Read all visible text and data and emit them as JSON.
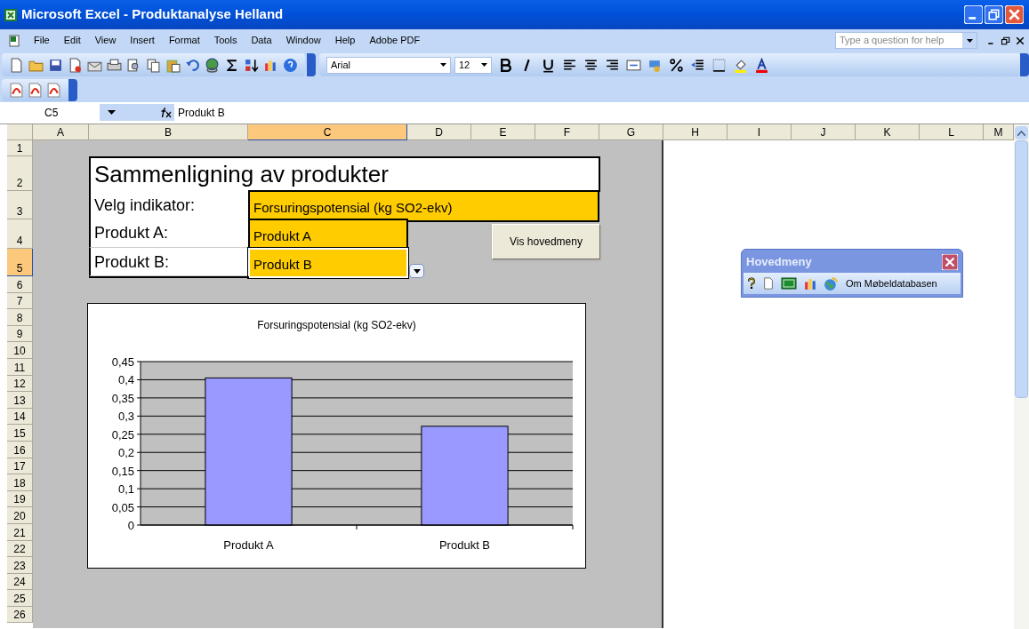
{
  "window": {
    "title": "Microsoft Excel - Produktanalyse Helland"
  },
  "menu_bar": {
    "items": [
      "File",
      "Edit",
      "View",
      "Insert",
      "Format",
      "Tools",
      "Data",
      "Window",
      "Help",
      "Adobe PDF"
    ],
    "help_box": {
      "placeholder": "Type a question for help"
    }
  },
  "formatting_toolbar": {
    "font": "Arial",
    "size": "12"
  },
  "formula_bar": {
    "name_box": "C5",
    "formula": "Produkt B"
  },
  "columns": [
    {
      "label": "A",
      "selected": false
    },
    {
      "label": "B",
      "selected": false
    },
    {
      "label": "C",
      "selected": true
    },
    {
      "label": "D",
      "selected": false
    },
    {
      "label": "E",
      "selected": false
    },
    {
      "label": "F",
      "selected": false
    },
    {
      "label": "G",
      "selected": false
    },
    {
      "label": "H",
      "selected": false
    },
    {
      "label": "I",
      "selected": false
    },
    {
      "label": "J",
      "selected": false
    },
    {
      "label": "K",
      "selected": false
    },
    {
      "label": "L",
      "selected": false
    },
    {
      "label": "M",
      "selected": false
    }
  ],
  "rows": [
    {
      "label": "1",
      "selected": false
    },
    {
      "label": "2",
      "selected": false
    },
    {
      "label": "3",
      "selected": false
    },
    {
      "label": "4",
      "selected": false
    },
    {
      "label": "5",
      "selected": true
    },
    {
      "label": "6",
      "selected": false
    },
    {
      "label": "7",
      "selected": false
    },
    {
      "label": "8",
      "selected": false
    },
    {
      "label": "9",
      "selected": false
    },
    {
      "label": "10",
      "selected": false
    },
    {
      "label": "11",
      "selected": false
    },
    {
      "label": "12",
      "selected": false
    },
    {
      "label": "13",
      "selected": false
    },
    {
      "label": "14",
      "selected": false
    },
    {
      "label": "15",
      "selected": false
    },
    {
      "label": "16",
      "selected": false
    },
    {
      "label": "17",
      "selected": false
    },
    {
      "label": "18",
      "selected": false
    },
    {
      "label": "19",
      "selected": false
    },
    {
      "label": "20",
      "selected": false
    },
    {
      "label": "21",
      "selected": false
    },
    {
      "label": "22",
      "selected": false
    },
    {
      "label": "23",
      "selected": false
    },
    {
      "label": "24",
      "selected": false
    },
    {
      "label": "25",
      "selected": false
    },
    {
      "label": "26",
      "selected": false
    }
  ],
  "sheet": {
    "title": "Sammenligning av produkter",
    "fields": [
      {
        "label": "Velg indikator:",
        "value": "Forsuringspotensial (kg SO2-ekv)",
        "selected": false
      },
      {
        "label": "Produkt A:",
        "value": "Produkt A",
        "selected": false
      },
      {
        "label": "Produkt B:",
        "value": "Produkt B",
        "selected": true
      }
    ],
    "button": "Vis hovedmeny",
    "chart_data": {
      "type": "bar",
      "title": "Forsuringspotensial (kg SO2-ekv)",
      "categories": [
        "Produkt A",
        "Produkt B"
      ],
      "series": [
        {
          "color": "#9999ff",
          "values": [
            0.405,
            0.272
          ]
        }
      ],
      "grid": true,
      "ylim": [
        0,
        0.45
      ],
      "yticks": [
        {
          "value": 0,
          "label": "0"
        },
        {
          "value": 0.05,
          "label": "0,05"
        },
        {
          "value": 0.1,
          "label": "0,1"
        },
        {
          "value": 0.15,
          "label": "0,15"
        },
        {
          "value": 0.2,
          "label": "0,2"
        },
        {
          "value": 0.25,
          "label": "0,25"
        },
        {
          "value": 0.3,
          "label": "0,3"
        },
        {
          "value": 0.35,
          "label": "0,35"
        },
        {
          "value": 0.4,
          "label": "0,4"
        },
        {
          "value": 0.45,
          "label": "0,45"
        }
      ]
    }
  },
  "floating_toolbar": {
    "title": "Hovedmeny",
    "link": "Om Møbeldatabasen"
  }
}
